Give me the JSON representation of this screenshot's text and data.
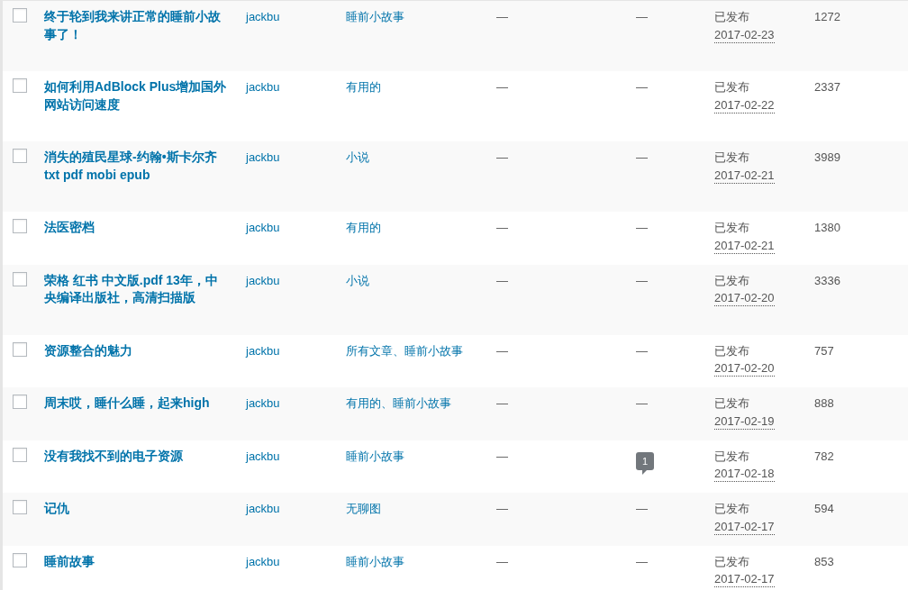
{
  "rows": [
    {
      "title": "终于轮到我来讲正常的睡前小故事了！",
      "author": "jackbu",
      "categories": "睡前小故事",
      "tags": "—",
      "comments": {
        "kind": "dash",
        "text": "—"
      },
      "status": "已发布",
      "date": "2017-02-23",
      "views": "1272",
      "checked": false
    },
    {
      "title": "如何利用AdBlock Plus增加国外网站访问速度",
      "author": "jackbu",
      "categories": "有用的",
      "tags": "—",
      "comments": {
        "kind": "dash",
        "text": "—"
      },
      "status": "已发布",
      "date": "2017-02-22",
      "views": "2337",
      "checked": false
    },
    {
      "title": "消失的殖民星球-约翰•斯卡尔齐 txt pdf mobi epub",
      "author": "jackbu",
      "categories": "小说",
      "tags": "—",
      "comments": {
        "kind": "dash",
        "text": "—"
      },
      "status": "已发布",
      "date": "2017-02-21",
      "views": "3989",
      "checked": false
    },
    {
      "title": "法医密档",
      "author": "jackbu",
      "categories": "有用的",
      "tags": "—",
      "comments": {
        "kind": "dash",
        "text": "—"
      },
      "status": "已发布",
      "date": "2017-02-21",
      "views": "1380",
      "checked": false
    },
    {
      "title": "荣格 红书 中文版.pdf 13年，中央编译出版社，高清扫描版",
      "author": "jackbu",
      "categories": "小说",
      "tags": "—",
      "comments": {
        "kind": "dash",
        "text": "—"
      },
      "status": "已发布",
      "date": "2017-02-20",
      "views": "3336",
      "checked": false
    },
    {
      "title": "资源整合的魅力",
      "author": "jackbu",
      "categories": "所有文章、睡前小故事",
      "tags": "—",
      "comments": {
        "kind": "dash",
        "text": "—"
      },
      "status": "已发布",
      "date": "2017-02-20",
      "views": "757",
      "checked": false
    },
    {
      "title": "周末哎，睡什么睡，起来high",
      "author": "jackbu",
      "categories": "有用的、睡前小故事",
      "tags": "—",
      "comments": {
        "kind": "dash",
        "text": "—"
      },
      "status": "已发布",
      "date": "2017-02-19",
      "views": "888",
      "checked": false
    },
    {
      "title": "没有我找不到的电子资源",
      "author": "jackbu",
      "categories": "睡前小故事",
      "tags": "—",
      "comments": {
        "kind": "bubble",
        "text": "1"
      },
      "status": "已发布",
      "date": "2017-02-18",
      "views": "782",
      "checked": false
    },
    {
      "title": "记仇",
      "author": "jackbu",
      "categories": "无聊图",
      "tags": "—",
      "comments": {
        "kind": "dash",
        "text": "—"
      },
      "status": "已发布",
      "date": "2017-02-17",
      "views": "594",
      "checked": false
    },
    {
      "title": "睡前故事",
      "author": "jackbu",
      "categories": "睡前小故事",
      "tags": "—",
      "comments": {
        "kind": "dash",
        "text": "—"
      },
      "status": "已发布",
      "date": "2017-02-17",
      "views": "853",
      "checked": false
    }
  ]
}
